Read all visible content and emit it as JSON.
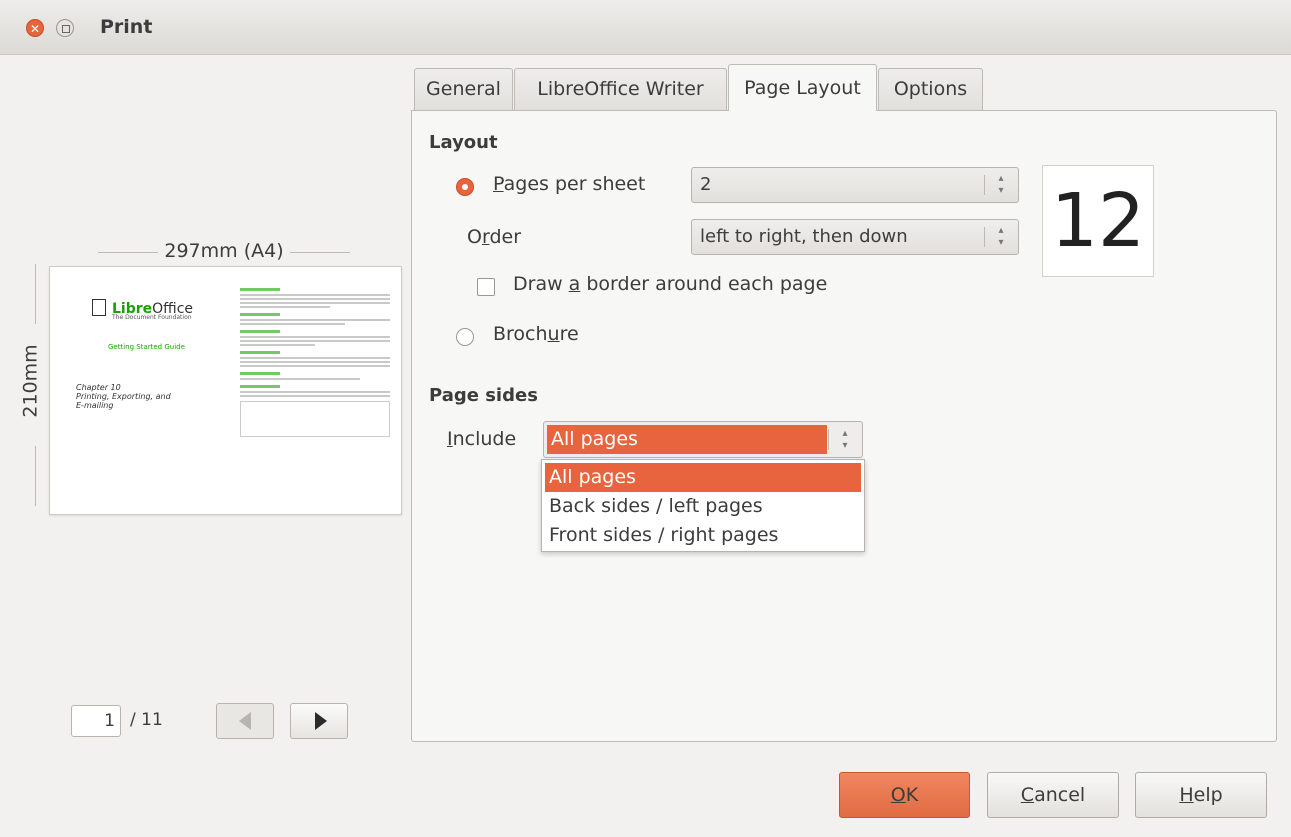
{
  "window": {
    "title": "Print"
  },
  "preview": {
    "width_label": "297mm (A4)",
    "height_label": "210mm",
    "thumb": {
      "logo_prefix": "Libre",
      "logo_suffix": "Office",
      "foundation": "The Document Foundation",
      "guide": "Getting Started Guide",
      "chapter_lines": [
        "Chapter 10",
        "Printing, Exporting, and",
        "E-mailing"
      ]
    },
    "current_page": "1",
    "total_pages": "/ 11"
  },
  "tabs": [
    "General",
    "LibreOffice Writer",
    "Page Layout",
    "Options"
  ],
  "active_tab": "Page Layout",
  "layout": {
    "section_title": "Layout",
    "pages_per_sheet": {
      "prefix": "",
      "mnemonic": "P",
      "rest": "ages per sheet",
      "value": "2",
      "selected": true
    },
    "order": {
      "prefix": "O",
      "mnemonic": "r",
      "rest": "der",
      "value": "left to right, then down"
    },
    "border": {
      "prefix": "Draw ",
      "mnemonic": "a",
      "rest": " border around each page",
      "checked": false
    },
    "brochure": {
      "prefix": "Broch",
      "mnemonic": "u",
      "rest": "re",
      "selected": false
    },
    "preview_number": "12"
  },
  "page_sides": {
    "section_title": "Page sides",
    "include": {
      "prefix": "",
      "mnemonic": "I",
      "rest": "nclude",
      "value": "All pages"
    },
    "options": [
      "All pages",
      "Back sides / left pages",
      "Front sides / right pages"
    ],
    "highlighted_option": "All pages"
  },
  "buttons": {
    "ok": {
      "mnemonic": "O",
      "rest": "K"
    },
    "cancel": {
      "mnemonic": "C",
      "rest": "ancel"
    },
    "help": {
      "mnemonic": "H",
      "rest": "elp"
    }
  },
  "colors": {
    "accent": "#e8643e",
    "window_bg": "#f2f1f0",
    "panel_bg": "#f7f7f6",
    "logo_green": "#18a303"
  }
}
